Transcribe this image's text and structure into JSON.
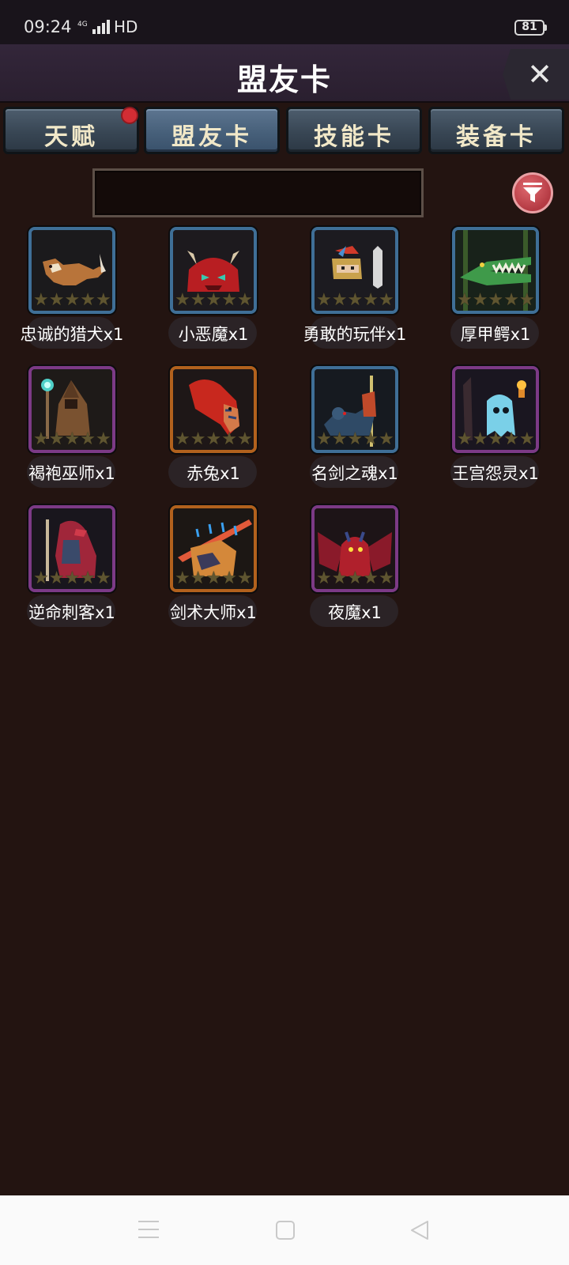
{
  "status_bar": {
    "time": "09:24",
    "network": "4G",
    "hd": "HD",
    "battery": "81"
  },
  "header": {
    "title": "盟友卡",
    "close_icon": "close-icon"
  },
  "tabs": [
    {
      "label": "天赋",
      "active": false,
      "badge": true
    },
    {
      "label": "盟友卡",
      "active": true,
      "badge": false
    },
    {
      "label": "技能卡",
      "active": false,
      "badge": false
    },
    {
      "label": "装备卡",
      "active": false,
      "badge": false
    }
  ],
  "search": {
    "value": "",
    "placeholder": ""
  },
  "filter": {
    "icon": "filter-icon",
    "color": "#c1474f"
  },
  "cards": [
    {
      "name": "忠诚的猎犬x1",
      "frame": "blue",
      "stars": 5,
      "art": "hound"
    },
    {
      "name": "小恶魔x1",
      "frame": "blue",
      "stars": 5,
      "art": "imp"
    },
    {
      "name": "勇敢的玩伴x1",
      "frame": "blue",
      "stars": 5,
      "art": "knight"
    },
    {
      "name": "厚甲鳄x1",
      "frame": "blue",
      "stars": 5,
      "art": "crocodile"
    },
    {
      "name": "褐袍巫师x1",
      "frame": "purple",
      "stars": 5,
      "art": "wizard"
    },
    {
      "name": "赤兔x1",
      "frame": "orange",
      "stars": 5,
      "art": "red-horse"
    },
    {
      "name": "名剑之魂x1",
      "frame": "blue",
      "stars": 5,
      "art": "sword-spirit"
    },
    {
      "name": "王宫怨灵x1",
      "frame": "purple",
      "stars": 5,
      "art": "ghost"
    },
    {
      "name": "逆命刺客x1",
      "frame": "purple",
      "stars": 5,
      "art": "assassin"
    },
    {
      "name": "剑术大师x1",
      "frame": "orange",
      "stars": 5,
      "art": "sword-master"
    },
    {
      "name": "夜魔x1",
      "frame": "purple",
      "stars": 5,
      "art": "night-demon"
    }
  ],
  "colors": {
    "background": "#231411",
    "header": "#2e2233",
    "tab": "#3d4b59",
    "tab_active": "#4a6480",
    "tab_text": "#f1e8c8",
    "badge": "#d22d34",
    "frame_blue": "#3f6f97",
    "frame_purple": "#7c3a86",
    "frame_orange": "#b2611d",
    "star": "#5f5530"
  },
  "nav": {
    "menu_icon": "menu-icon",
    "home_icon": "home-icon",
    "back_icon": "back-icon"
  }
}
